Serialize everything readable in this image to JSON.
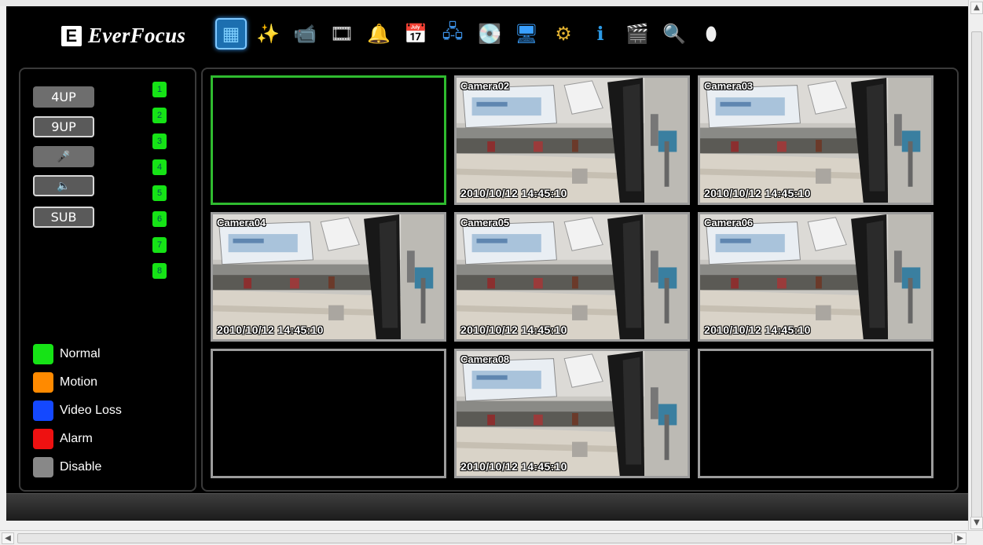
{
  "brand": {
    "mark": "E",
    "name": "EverFocus"
  },
  "toolbar": [
    {
      "name": "live-view-icon",
      "glyph": "▦",
      "color": "#7fd0ff",
      "active": true
    },
    {
      "name": "magic-wand-icon",
      "glyph": "✨",
      "color": "#ffffff"
    },
    {
      "name": "camera-icon",
      "glyph": "📹",
      "color": "#cccccc"
    },
    {
      "name": "playback-reel-icon",
      "glyph": "🎞",
      "color": "#dddddd"
    },
    {
      "name": "alarm-bell-icon",
      "glyph": "🔔",
      "color": "#f0b020"
    },
    {
      "name": "schedule-icon",
      "glyph": "📅",
      "color": "#7ad07a"
    },
    {
      "name": "network-icon",
      "glyph": "🖧",
      "color": "#3a8de0"
    },
    {
      "name": "disk-icon",
      "glyph": "💽",
      "color": "#d8a050"
    },
    {
      "name": "monitor-icon",
      "glyph": "🖥",
      "color": "#3aa0ff"
    },
    {
      "name": "settings-gears-icon",
      "glyph": "⚙",
      "color": "#e0b030"
    },
    {
      "name": "info-icon",
      "glyph": "ℹ",
      "color": "#2c9be8"
    },
    {
      "name": "film-icon",
      "glyph": "🎬",
      "color": "#aaccee"
    },
    {
      "name": "search-document-icon",
      "glyph": "🔍",
      "color": "#e0c070"
    },
    {
      "name": "dome-camera-icon",
      "glyph": "⬮",
      "color": "#eeeeee"
    }
  ],
  "side_buttons": {
    "btn_4up": "4UP",
    "btn_9up": "9UP",
    "btn_mic": "🎤",
    "btn_audio": "🔈",
    "btn_sub": "SUB"
  },
  "channels": [
    "1",
    "2",
    "3",
    "4",
    "5",
    "6",
    "7",
    "8"
  ],
  "legend": [
    {
      "label": "Normal",
      "color": "#16e316"
    },
    {
      "label": "Motion",
      "color": "#ff8a00"
    },
    {
      "label": "Video Loss",
      "color": "#1448ff"
    },
    {
      "label": "Alarm",
      "color": "#ee1111"
    },
    {
      "label": "Disable",
      "color": "#888888"
    }
  ],
  "cells": [
    {
      "camera": "",
      "timestamp": "",
      "selected": true,
      "video": false
    },
    {
      "camera": "Camera02",
      "timestamp": "2010/10/12  14:45:10",
      "selected": false,
      "video": true
    },
    {
      "camera": "Camera03",
      "timestamp": "2010/10/12  14:45:10",
      "selected": false,
      "video": true
    },
    {
      "camera": "Camera04",
      "timestamp": "2010/10/12  14:45:10",
      "selected": false,
      "video": true
    },
    {
      "camera": "Camera05",
      "timestamp": "2010/10/12  14:45:10",
      "selected": false,
      "video": true
    },
    {
      "camera": "Camera06",
      "timestamp": "2010/10/12  14:45:10",
      "selected": false,
      "video": true
    },
    {
      "camera": "",
      "timestamp": "",
      "selected": false,
      "video": false
    },
    {
      "camera": "Camera08",
      "timestamp": "2010/10/12  14:45:10",
      "selected": false,
      "video": true
    },
    {
      "camera": "",
      "timestamp": "",
      "selected": false,
      "video": false
    }
  ],
  "scrollbar": {
    "up": "▲",
    "down": "▼",
    "left": "◀",
    "right": "▶"
  }
}
